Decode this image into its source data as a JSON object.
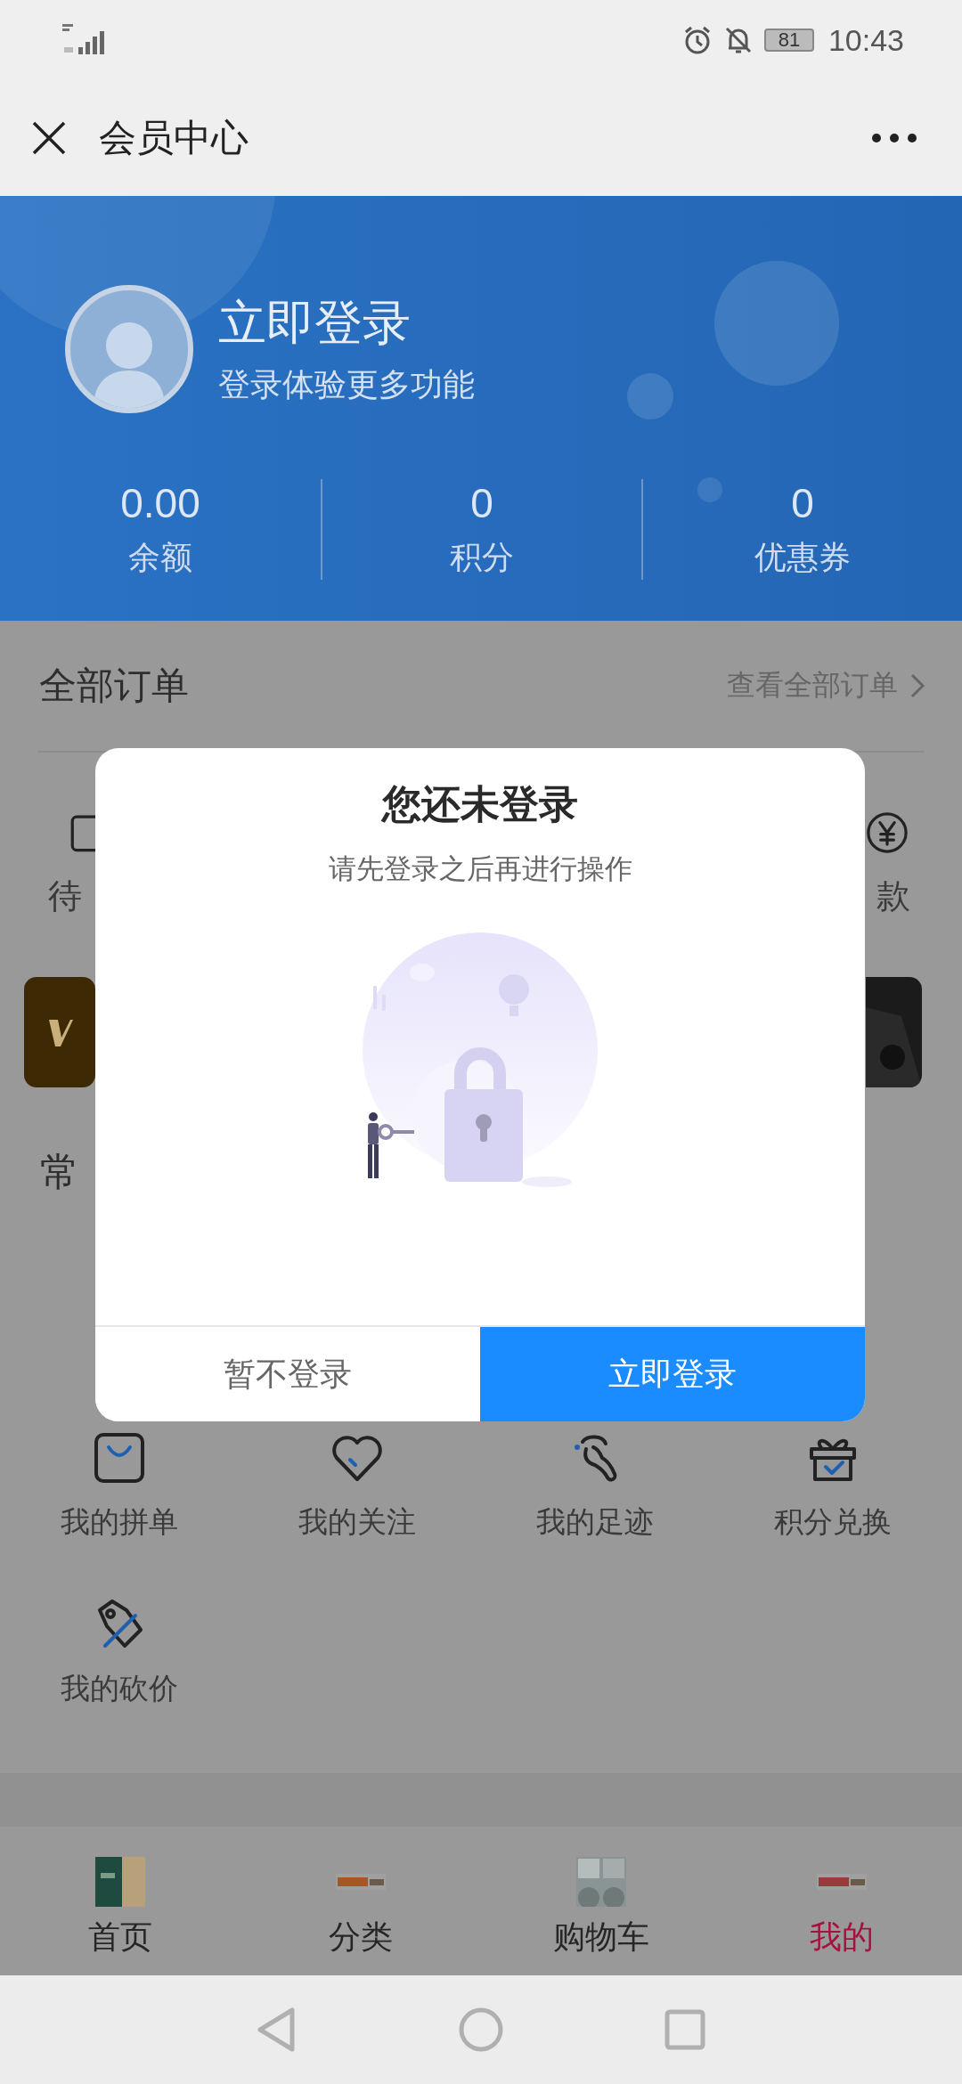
{
  "status_bar": {
    "battery": "81",
    "time": "10:43"
  },
  "app_bar": {
    "title": "会员中心"
  },
  "profile": {
    "login": "立即登录",
    "subtitle": "登录体验更多功能",
    "stats": [
      {
        "value": "0.00",
        "label": "余额"
      },
      {
        "value": "0",
        "label": "积分"
      },
      {
        "value": "0",
        "label": "优惠券"
      }
    ]
  },
  "orders": {
    "title": "全部订单",
    "link": "查看全部订单",
    "items": [
      {
        "kind": "card",
        "label": "待"
      },
      {
        "kind": "yen",
        "label": "款"
      }
    ]
  },
  "common": {
    "title": "常",
    "tools": [
      {
        "kind": "bag",
        "label": "我的拼单"
      },
      {
        "kind": "heart",
        "label": "我的关注"
      },
      {
        "kind": "footprint",
        "label": "我的足迹"
      },
      {
        "kind": "gift",
        "label": "积分兑换"
      },
      {
        "kind": "tag",
        "label": "我的砍价"
      }
    ]
  },
  "tab_bar": [
    {
      "label": "首页",
      "selected": false
    },
    {
      "label": "分类",
      "selected": false
    },
    {
      "label": "购物车",
      "selected": false
    },
    {
      "label": "我的",
      "selected": true
    }
  ],
  "dialog": {
    "title": "您还未登录",
    "message": "请先登录之后再进行操作",
    "buttons": [
      {
        "kind": "secondary",
        "label": "暂不登录"
      },
      {
        "kind": "primary",
        "label": "立即登录"
      }
    ]
  }
}
